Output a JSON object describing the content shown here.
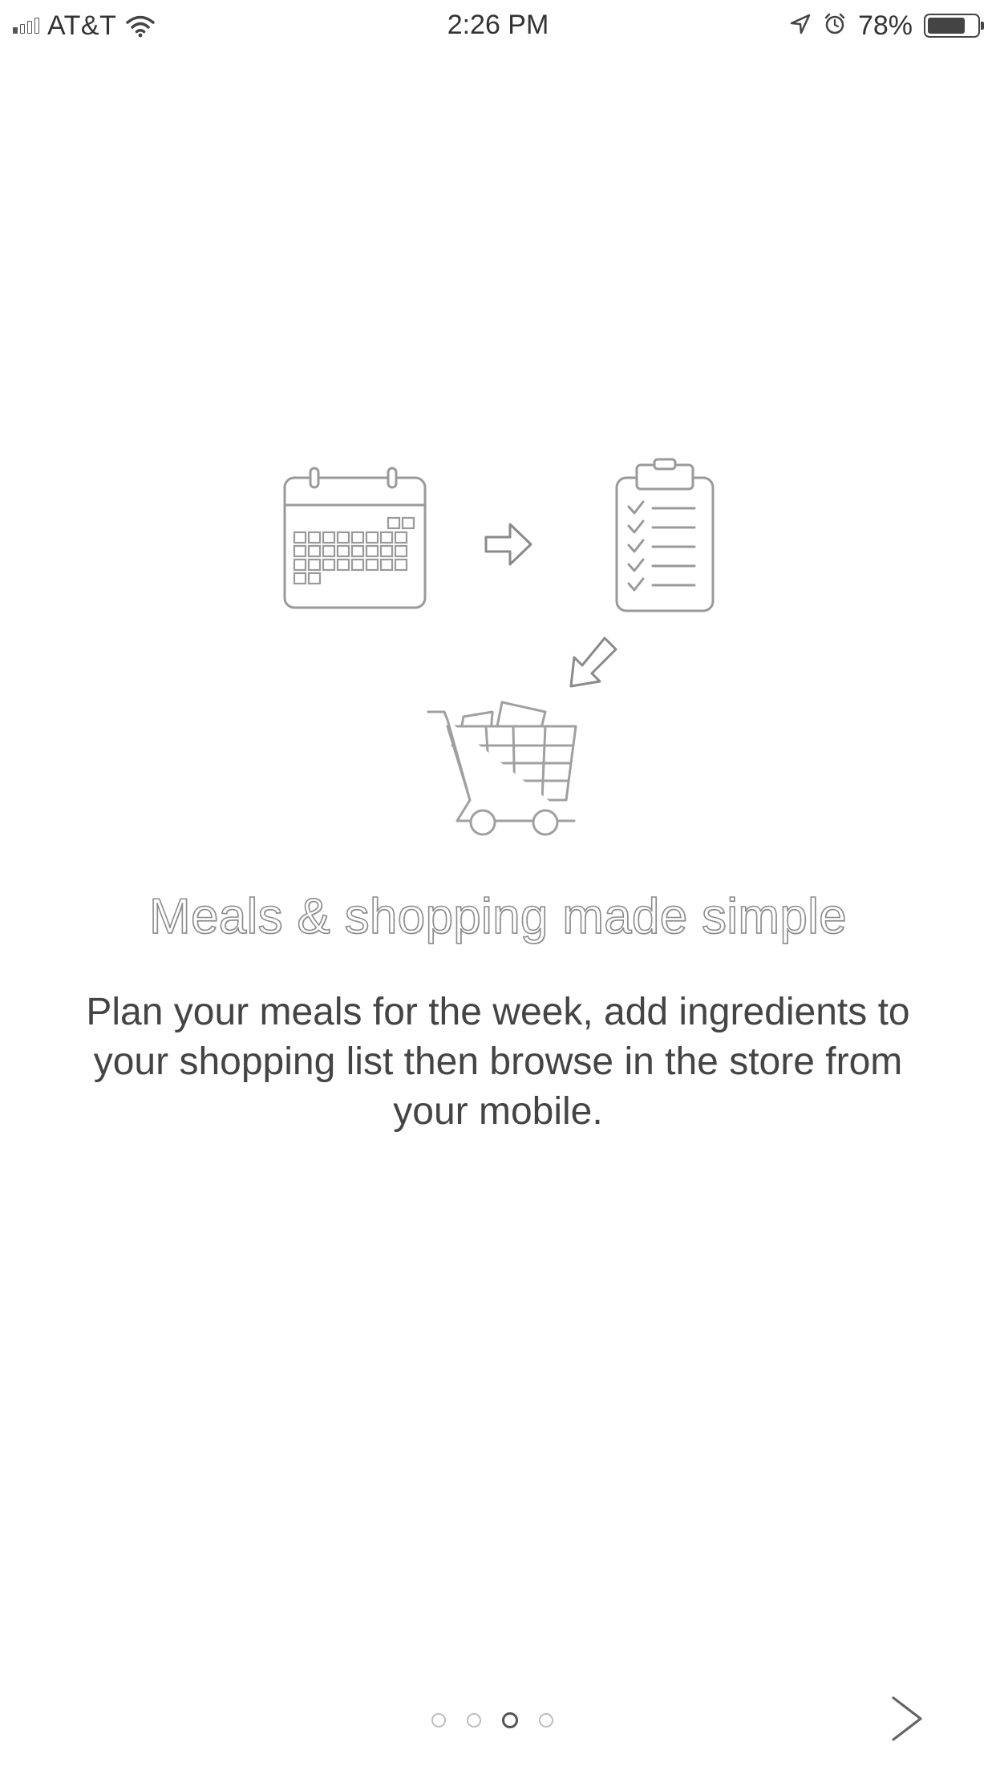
{
  "status_bar": {
    "carrier": "AT&T",
    "time": "2:26 PM",
    "battery_percent": "78%",
    "battery_level": 0.78,
    "signal_bars_filled": 1,
    "signal_bars_total": 4,
    "icons": [
      "signal-icon",
      "wifi-icon",
      "location-arrow-icon",
      "alarm-icon",
      "battery-icon"
    ]
  },
  "onboarding": {
    "illustration_icons": [
      "calendar-icon",
      "right-arrow-icon",
      "checklist-clipboard-icon",
      "down-left-arrow-icon",
      "shopping-cart-icon"
    ],
    "title": "Meals & shopping made simple",
    "description": "Plan your meals for the week, add ingredients to your shopping list then browse in the store from your mobile."
  },
  "pagination": {
    "total_pages": 4,
    "current_page": 3
  },
  "navigation": {
    "next_icon": "chevron-right-icon"
  },
  "colors": {
    "background": "#ffffff",
    "text": "#444444",
    "outline": "#8c8c8c",
    "dot_inactive": "#bdbdbd",
    "dot_active": "#555555"
  }
}
